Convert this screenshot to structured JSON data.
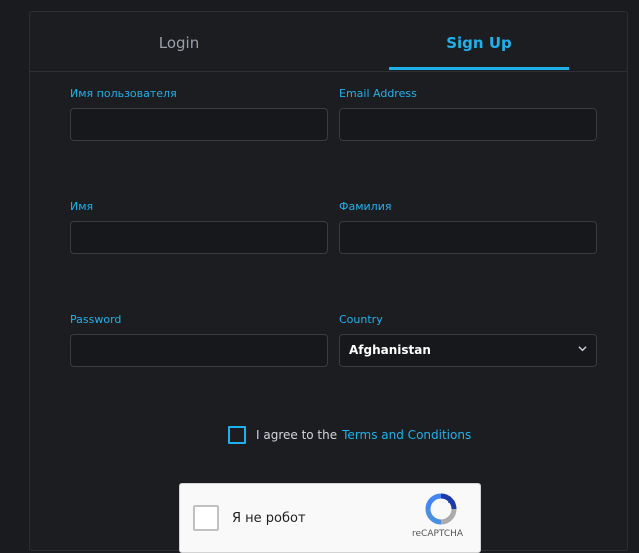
{
  "tabs": {
    "login": "Login",
    "signup": "Sign Up"
  },
  "form": {
    "username_label": "Имя пользователя",
    "email_label": "Email Address",
    "firstname_label": "Имя",
    "lastname_label": "Фамилия",
    "password_label": "Password",
    "country_label": "Country",
    "country_value": "Afghanistan"
  },
  "agree": {
    "text": "I agree to the",
    "link": "Terms and Conditions"
  },
  "captcha": {
    "label": "Я не робот",
    "brand": "reCAPTCHA",
    "logo_icon": "recaptcha-logo-icon"
  },
  "colors": {
    "accent": "#1fb1ea",
    "background": "#1a1b1f",
    "input_border": "#3a3c42"
  }
}
